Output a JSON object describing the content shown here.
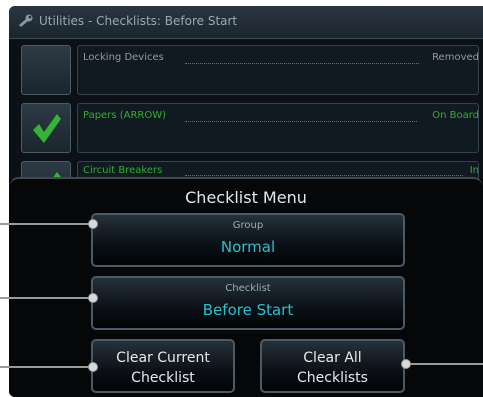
{
  "window": {
    "title": "Utilities - Checklists: Before Start",
    "icon": "wrench-icon"
  },
  "checklist": {
    "items": [
      {
        "label": "Locking Devices",
        "status": "Removed",
        "checked": false
      },
      {
        "label": "Papers (ARROW)",
        "status": "On Board",
        "checked": true
      },
      {
        "label": "Circuit Breakers",
        "status": "In",
        "checked": true
      }
    ]
  },
  "menu": {
    "title": "Checklist Menu",
    "group": {
      "label": "Group",
      "value": "Normal"
    },
    "checklist": {
      "label": "Checklist",
      "value": "Before Start"
    },
    "clear_current": "Clear Current\nChecklist",
    "clear_all": "Clear All\nChecklists"
  },
  "colors": {
    "checked_text": "#2fb02f",
    "check_mark": "#33b533",
    "value_text": "#24c3cf",
    "button_border": "#4b5a66",
    "callout": "#9a9a9a"
  }
}
